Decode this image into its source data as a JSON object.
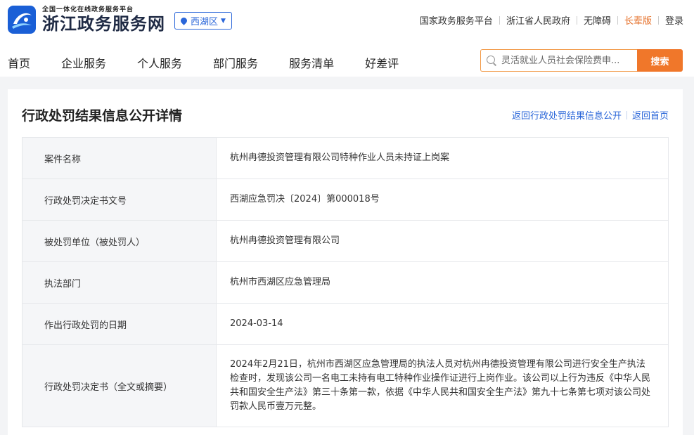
{
  "header": {
    "logo_subtitle": "全国一体化在线政务服务平台",
    "logo_title": "浙江政务服务网",
    "region": "西湖区",
    "top_links": [
      "国家政务服务平台",
      "浙江省人民政府",
      "无障碍",
      "长辈版",
      "登录"
    ]
  },
  "nav": {
    "items": [
      "首页",
      "企业服务",
      "个人服务",
      "部门服务",
      "服务清单",
      "好差评"
    ]
  },
  "search": {
    "placeholder": "灵活就业人员社会保险费申...",
    "button_label": "搜索"
  },
  "panel": {
    "title": "行政处罚结果信息公开详情",
    "back_list_link": "返回行政处罚结果信息公开",
    "back_home_link": "返回首页"
  },
  "table": {
    "rows": [
      {
        "label": "案件名称",
        "value": "杭州冉德投资管理有限公司特种作业人员未持证上岗案"
      },
      {
        "label": "行政处罚决定书文号",
        "value": "西湖应急罚决〔2024〕第000018号"
      },
      {
        "label": "被处罚单位（被处罚人）",
        "value": "杭州冉德投资管理有限公司"
      },
      {
        "label": "执法部门",
        "value": "杭州市西湖区应急管理局"
      },
      {
        "label": "作出行政处罚的日期",
        "value": "2024-03-14"
      },
      {
        "label": "行政处罚决定书（全文或摘要）",
        "value": "2024年2月21日，杭州市西湖区应急管理局的执法人员对杭州冉德投资管理有限公司进行安全生产执法检查时，发现该公司一名电工未持有电工特种作业操作证进行上岗作业。该公司以上行为违反《中华人民共和国安全生产法》第三十条第一款，依据《中华人民共和国安全生产法》第九十七条第七项对该公司处罚款人民币壹万元整。"
      }
    ]
  },
  "colors": {
    "brand_blue": "#1a5fd6",
    "link_blue": "#2a66d9",
    "accent_orange": "#f0772a"
  }
}
